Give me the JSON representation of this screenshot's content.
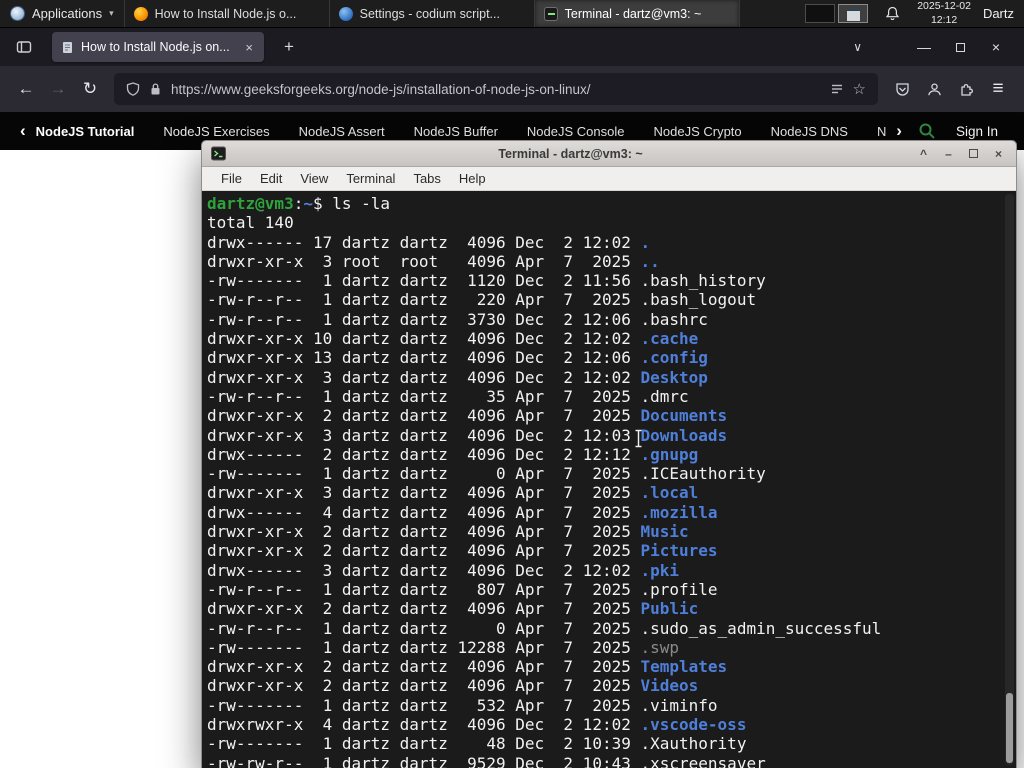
{
  "panel": {
    "applications": "Applications",
    "tasks": [
      {
        "label": "How to Install Node.js o...",
        "icon": "firefox-icon",
        "active": false
      },
      {
        "label": "Settings - codium script...",
        "icon": "settings-icon",
        "active": false
      },
      {
        "label": "Terminal - dartz@vm3: ~",
        "icon": "terminal-icon",
        "active": true
      }
    ],
    "clock": {
      "date": "2025-12-02",
      "time": "12:12"
    },
    "user": "Dartz"
  },
  "browser": {
    "tab": {
      "title": "How to Install Node.js on..."
    },
    "url": "https://www.geeksforgeeks.org/node-js/installation-of-node-js-on-linux/"
  },
  "ribbon": {
    "items": [
      {
        "label": "NodeJS Tutorial",
        "bold": true
      },
      {
        "label": "NodeJS Exercises",
        "bold": false
      },
      {
        "label": "NodeJS Assert",
        "bold": false
      },
      {
        "label": "NodeJS Buffer",
        "bold": false
      },
      {
        "label": "NodeJS Console",
        "bold": false
      },
      {
        "label": "NodeJS Crypto",
        "bold": false
      },
      {
        "label": "NodeJS DNS",
        "bold": false
      },
      {
        "label": "NodeJS",
        "bold": false
      }
    ],
    "sign_in": "Sign In"
  },
  "terminal": {
    "title": "Terminal - dartz@vm3: ~",
    "menu": [
      "File",
      "Edit",
      "View",
      "Terminal",
      "Tabs",
      "Help"
    ],
    "prompt": {
      "user_host": "dartz@vm3",
      "separator": ":",
      "path": "~",
      "symbol": "$",
      "command": " ls -la"
    },
    "total": "total 140",
    "entries": [
      {
        "pre": "drwx------ 17 dartz dartz  4096 Dec  2 12:02 ",
        "name": ".",
        "type": "dir"
      },
      {
        "pre": "drwxr-xr-x  3 root  root   4096 Apr  7  2025 ",
        "name": "..",
        "type": "dir"
      },
      {
        "pre": "-rw-------  1 dartz dartz  1120 Dec  2 11:56 ",
        "name": ".bash_history",
        "type": "file"
      },
      {
        "pre": "-rw-r--r--  1 dartz dartz   220 Apr  7  2025 ",
        "name": ".bash_logout",
        "type": "file"
      },
      {
        "pre": "-rw-r--r--  1 dartz dartz  3730 Dec  2 12:06 ",
        "name": ".bashrc",
        "type": "file"
      },
      {
        "pre": "drwxr-xr-x 10 dartz dartz  4096 Dec  2 12:02 ",
        "name": ".cache",
        "type": "dir"
      },
      {
        "pre": "drwxr-xr-x 13 dartz dartz  4096 Dec  2 12:06 ",
        "name": ".config",
        "type": "dir"
      },
      {
        "pre": "drwxr-xr-x  3 dartz dartz  4096 Dec  2 12:02 ",
        "name": "Desktop",
        "type": "dir"
      },
      {
        "pre": "-rw-r--r--  1 dartz dartz    35 Apr  7  2025 ",
        "name": ".dmrc",
        "type": "file"
      },
      {
        "pre": "drwxr-xr-x  2 dartz dartz  4096 Apr  7  2025 ",
        "name": "Documents",
        "type": "dir"
      },
      {
        "pre": "drwxr-xr-x  3 dartz dartz  4096 Dec  2 12:03 ",
        "name": "Downloads",
        "type": "dir"
      },
      {
        "pre": "drwx------  2 dartz dartz  4096 Dec  2 12:12 ",
        "name": ".gnupg",
        "type": "dir"
      },
      {
        "pre": "-rw-------  1 dartz dartz     0 Apr  7  2025 ",
        "name": ".ICEauthority",
        "type": "file"
      },
      {
        "pre": "drwxr-xr-x  3 dartz dartz  4096 Apr  7  2025 ",
        "name": ".local",
        "type": "dir"
      },
      {
        "pre": "drwx------  4 dartz dartz  4096 Apr  7  2025 ",
        "name": ".mozilla",
        "type": "dir"
      },
      {
        "pre": "drwxr-xr-x  2 dartz dartz  4096 Apr  7  2025 ",
        "name": "Music",
        "type": "dir"
      },
      {
        "pre": "drwxr-xr-x  2 dartz dartz  4096 Apr  7  2025 ",
        "name": "Pictures",
        "type": "dir"
      },
      {
        "pre": "drwx------  3 dartz dartz  4096 Dec  2 12:02 ",
        "name": ".pki",
        "type": "dir"
      },
      {
        "pre": "-rw-r--r--  1 dartz dartz   807 Apr  7  2025 ",
        "name": ".profile",
        "type": "file"
      },
      {
        "pre": "drwxr-xr-x  2 dartz dartz  4096 Apr  7  2025 ",
        "name": "Public",
        "type": "dir"
      },
      {
        "pre": "-rw-r--r--  1 dartz dartz     0 Apr  7  2025 ",
        "name": ".sudo_as_admin_successful",
        "type": "file"
      },
      {
        "pre": "-rw-------  1 dartz dartz 12288 Apr  7  2025 ",
        "name": ".swp",
        "type": "dim"
      },
      {
        "pre": "drwxr-xr-x  2 dartz dartz  4096 Apr  7  2025 ",
        "name": "Templates",
        "type": "dir"
      },
      {
        "pre": "drwxr-xr-x  2 dartz dartz  4096 Apr  7  2025 ",
        "name": "Videos",
        "type": "dir"
      },
      {
        "pre": "-rw-------  1 dartz dartz   532 Apr  7  2025 ",
        "name": ".viminfo",
        "type": "file"
      },
      {
        "pre": "drwxrwxr-x  4 dartz dartz  4096 Dec  2 12:02 ",
        "name": ".vscode-oss",
        "type": "dir"
      },
      {
        "pre": "-rw-------  1 dartz dartz    48 Dec  2 10:39 ",
        "name": ".Xauthority",
        "type": "file"
      },
      {
        "pre": "-rw-rw-r--  1 dartz dartz  9529 Dec  2 10:43 ",
        "name": ".xscreensaver",
        "type": "file"
      }
    ]
  },
  "icons": {
    "caret_down": "▾",
    "back": "←",
    "forward": "→",
    "reload": "↻",
    "star": "☆",
    "menu": "≡",
    "tab_close": "×",
    "tab_list": "∨",
    "win_min": "—",
    "win_close": "×",
    "shade": "^",
    "term_min": "–",
    "term_close": "×",
    "chevron_left": "‹",
    "chevron_right": "›",
    "new_tab": "+"
  },
  "colors": {
    "gfg_green": "#2f8d46",
    "dir_blue": "#4f7fd9",
    "prompt_green": "#2fa33c",
    "terminal_bg": "#1b1b1b",
    "accent_panel": "#1d1d1d"
  }
}
